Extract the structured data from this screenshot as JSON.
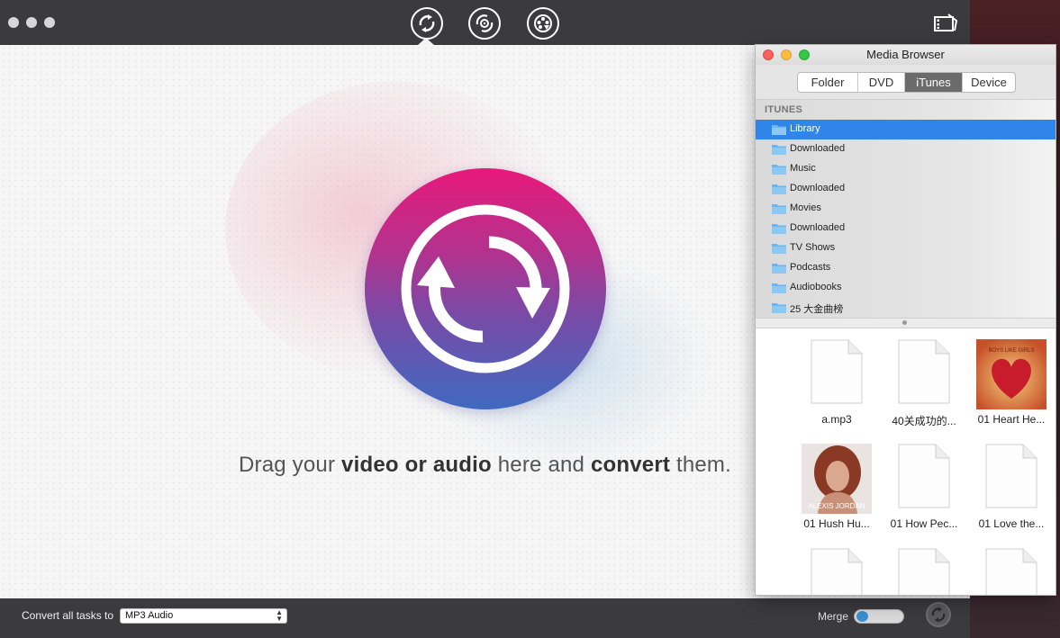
{
  "toolbar": {
    "tabs": [
      {
        "name": "convert-icon"
      },
      {
        "name": "burn-icon"
      },
      {
        "name": "dvd-rip-icon"
      }
    ],
    "film_icon": "film-icon"
  },
  "main": {
    "drag_text_pre": "Drag your ",
    "drag_text_bold1": "video or audio",
    "drag_text_mid": " here and ",
    "drag_text_bold2": "convert",
    "drag_text_post": " them."
  },
  "bottom": {
    "convert_label": "Convert all tasks to",
    "format_selected": "MP3 Audio",
    "merge_label": "Merge",
    "merge_enabled": false
  },
  "media_browser": {
    "title": "Media Browser",
    "tabs": [
      "Folder",
      "DVD",
      "iTunes",
      "Device"
    ],
    "active_tab": "iTunes",
    "section": "ITUNES",
    "items": [
      "Library",
      "Downloaded",
      "Music",
      "Downloaded",
      "Movies",
      "Downloaded",
      "TV Shows",
      "Podcasts",
      "Audiobooks",
      "25 大金曲榜"
    ],
    "selected_item": "Library",
    "files": [
      {
        "name": "a.mp3",
        "kind": "document"
      },
      {
        "name": "40关成功的...",
        "kind": "document"
      },
      {
        "name": "01 Heart He...",
        "kind": "album-art"
      },
      {
        "name": "01 Hush Hu...",
        "kind": "album-art"
      },
      {
        "name": "01 How Pec...",
        "kind": "document"
      },
      {
        "name": "01 Love the...",
        "kind": "document"
      },
      {
        "name": "",
        "kind": "document"
      },
      {
        "name": "",
        "kind": "document"
      },
      {
        "name": "",
        "kind": "document"
      }
    ],
    "album_art_text": {
      "heart": "BOYS LIKE GIRLS",
      "hush": "ALEXIS JORDAN"
    }
  },
  "colors": {
    "accent_blue": "#2f86e8",
    "gradient_top": "#e8197a",
    "gradient_bottom": "#3f6ac0",
    "toolbar": "#3b3b3d"
  }
}
